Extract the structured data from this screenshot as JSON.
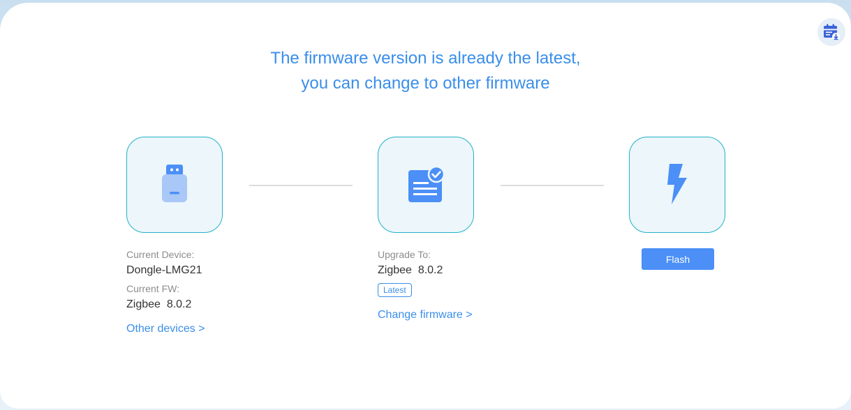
{
  "header": {
    "line1": "The firmware version is already the latest,",
    "line2": "you can change to other firmware",
    "top_icon": "calendar-download-icon"
  },
  "device_step": {
    "icon": "usb-dongle-icon",
    "current_device_label": "Current Device:",
    "current_device_value": "Dongle-LMG21",
    "current_fw_label": "Current FW:",
    "current_fw_value": "Zigbee  8.0.2",
    "link": "Other devices >"
  },
  "firmware_step": {
    "icon": "firmware-check-icon",
    "upgrade_label": "Upgrade To:",
    "upgrade_value": "Zigbee  8.0.2",
    "badge": "Latest",
    "link": "Change firmware >"
  },
  "flash_step": {
    "icon": "lightning-bolt-icon",
    "button_label": "Flash"
  },
  "colors": {
    "accent": "#3a8ee9",
    "button": "#4b8ff7",
    "box_border": "#22b1c8",
    "box_bg": "#ecf6fb"
  }
}
